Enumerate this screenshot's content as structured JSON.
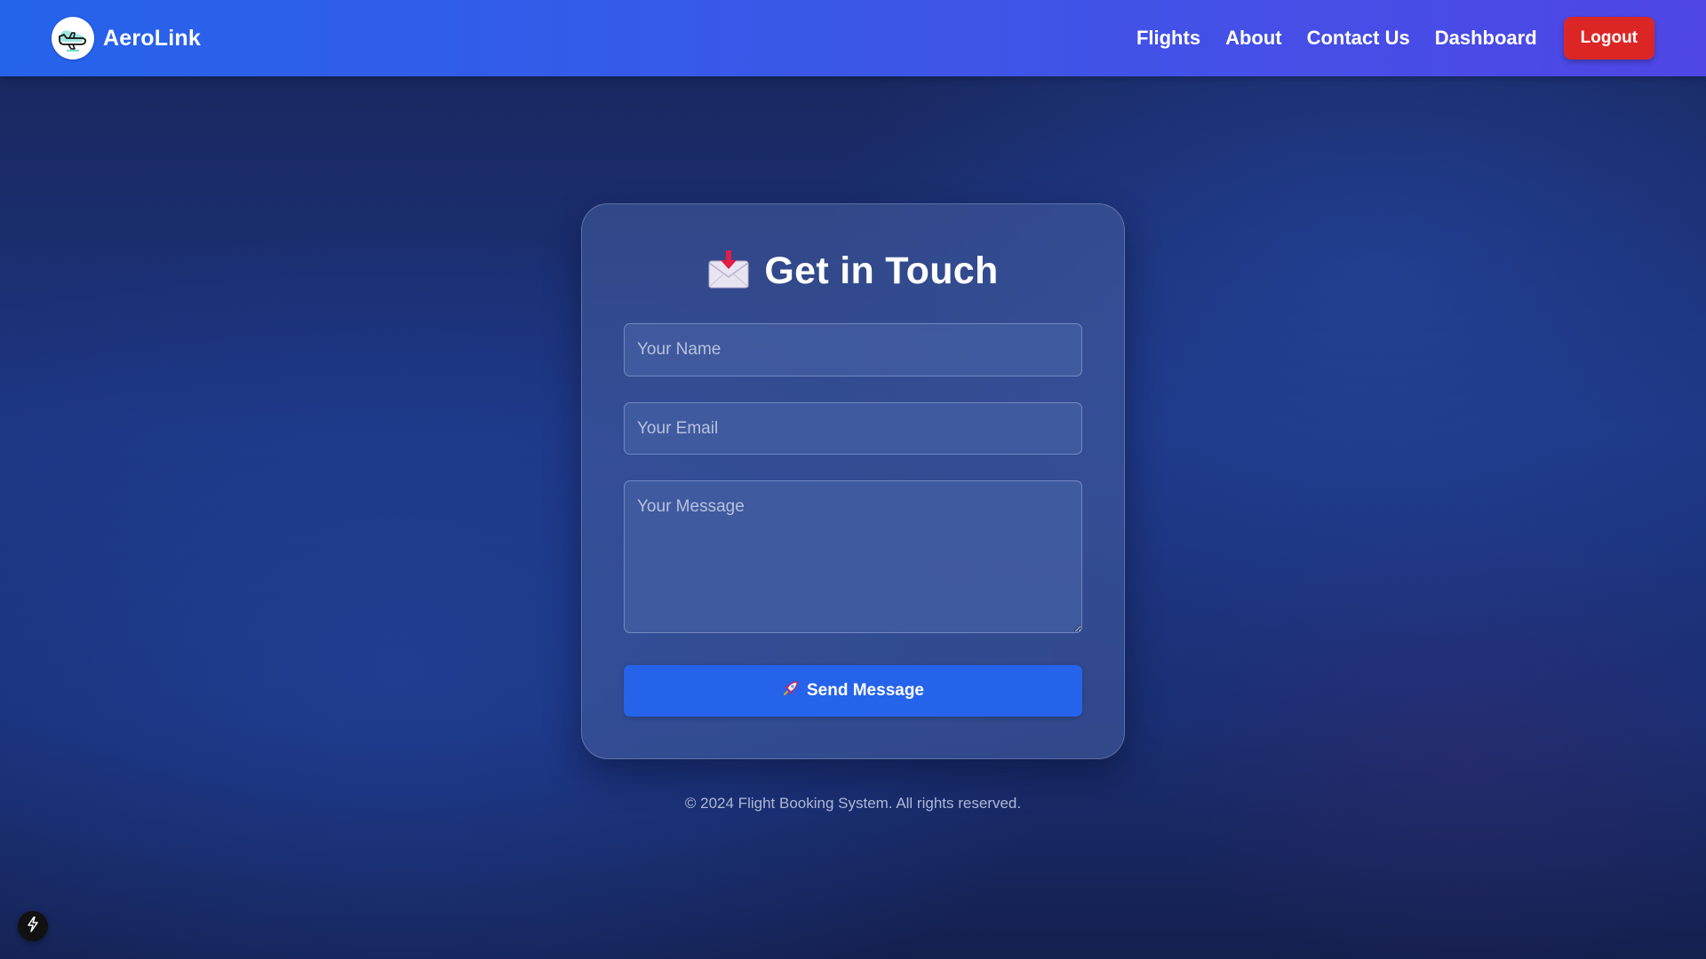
{
  "brand": {
    "name": "AeroLink",
    "logo_icon": "airplane-icon"
  },
  "nav": {
    "links": [
      "Flights",
      "About",
      "Contact Us",
      "Dashboard"
    ],
    "logout_label": "Logout"
  },
  "contact_form": {
    "title": "Get in Touch",
    "title_icon": "envelope-arrow-icon",
    "name_placeholder": "Your Name",
    "email_placeholder": "Your Email",
    "message_placeholder": "Your Message",
    "send_label": "Send Message",
    "send_icon": "rocket-icon"
  },
  "footer": {
    "text": "© 2024 Flight Booking System. All rights reserved."
  },
  "floating_button_icon": "lightning-icon",
  "colors": {
    "navbar_start": "#2563eb",
    "navbar_end": "#4f46e5",
    "logout": "#dc2626",
    "send_button": "#2563eb",
    "background": "#1d3580"
  }
}
